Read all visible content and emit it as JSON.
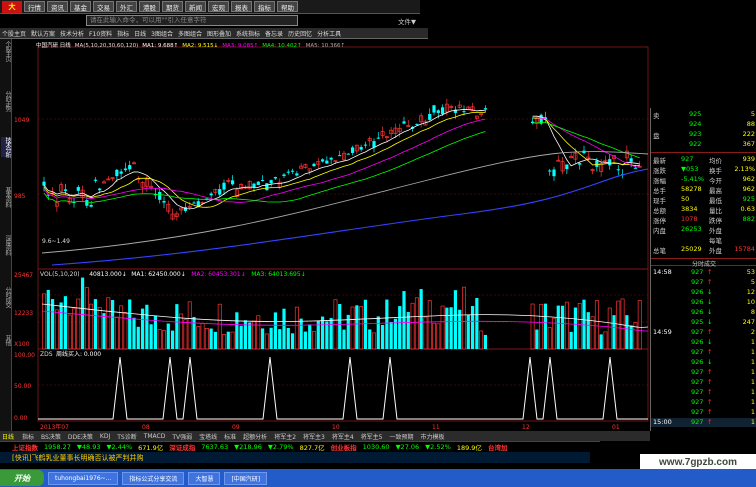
{
  "menu": {
    "items": [
      "行情",
      "资讯",
      "基金",
      "交易",
      "外汇",
      "港股",
      "期货",
      "新闻",
      "宏观",
      "报表",
      "指标",
      "帮助"
    ],
    "search_placeholder": "请在此输入命令，可以用\"\"引入任意字符",
    "right_label": "文件▼"
  },
  "toolbar": [
    "个股主页",
    "默认方案",
    "技术分析",
    "F10资料",
    "指标",
    "日线",
    "3图组合",
    "多图组合",
    "图形叠加",
    "系统指标",
    "备忘录",
    "历史回忆",
    "分析工具"
  ],
  "left_tabs": [
    "个股主页",
    "分时走势",
    "技术分析",
    "基本资料",
    "深度资料",
    "分时成交",
    "其他"
  ],
  "main": {
    "ma_line": [
      {
        "text": "中国汽研 日线",
        "color": "#ffffff"
      },
      {
        "text": "MA(5,10,20,30,60,120)",
        "color": "#dddddd"
      },
      {
        "text": "MA1: 9.688↑",
        "color": "#ffffff"
      },
      {
        "text": "MA2: 9.515↓",
        "color": "#ffff00"
      },
      {
        "text": "MA3: 9.085↑",
        "color": "#ff00ff"
      },
      {
        "text": "MA4: 10.402↑",
        "color": "#00ff00"
      },
      {
        "text": "MA5: 10.366↑",
        "color": "#aaaaaa"
      }
    ],
    "price_ticks": [
      "1049",
      "985"
    ],
    "low_label": "9.6~1.49",
    "vol_line": [
      {
        "text": "VOL(5,10,20)",
        "color": "#dddddd"
      },
      {
        "text": "40813.000↓",
        "color": "#ffffff"
      },
      {
        "text": "MA1: 62450.000↓",
        "color": "#ffffff"
      },
      {
        "text": "MA2: 60453.301↓",
        "color": "#ff00ff"
      },
      {
        "text": "MA3: 64013.695↓",
        "color": "#00ff00"
      }
    ],
    "vol_ticks": [
      "25467",
      "12233",
      "X100"
    ],
    "sig_line": [
      {
        "text": "ZDS",
        "color": "#dddddd"
      },
      {
        "text": "周线买入: 0.000",
        "color": "#ffffff"
      }
    ],
    "sig_ticks": [
      "100.00",
      "50.00",
      "0.00"
    ],
    "date_labels": [
      "2013年07",
      "08",
      "09",
      "10",
      "11",
      "12",
      "01"
    ],
    "period_tab": "日线"
  },
  "right_panel": {
    "quotes": [
      {
        "label": "卖",
        "price": "925",
        "vol": "5"
      },
      {
        "label": "",
        "price": "924",
        "vol": "88"
      },
      {
        "label": "盘",
        "price": "923",
        "vol": "222"
      },
      {
        "label": "",
        "price": "922",
        "vol": "367"
      }
    ],
    "stats": [
      {
        "k1": "最新",
        "v1": "927",
        "k2": "均价",
        "v2": "939",
        "c1": "#00ff00",
        "c2": "#ffff00"
      },
      {
        "k1": "涨跌",
        "v1": "▼053",
        "k2": "换手",
        "v2": "2.13%",
        "c1": "#00ff00",
        "c2": "#ffff00"
      },
      {
        "k1": "涨幅",
        "v1": "-5.41%",
        "k2": "今开",
        "v2": "962",
        "c1": "#00ff00",
        "c2": "#ffff00"
      },
      {
        "k1": "总手",
        "v1": "58278",
        "k2": "最高",
        "v2": "962",
        "c1": "#ffff00",
        "c2": "#ffff00"
      },
      {
        "k1": "现手",
        "v1": "50",
        "k2": "最低",
        "v2": "925",
        "c1": "#ffff00",
        "c2": "#00ff00"
      },
      {
        "k1": "总额",
        "v1": "3834",
        "k2": "量比",
        "v2": "0.63",
        "c1": "#ffff00",
        "c2": "#ffff00"
      },
      {
        "k1": "涨停",
        "v1": "1078",
        "k2": "跌停",
        "v2": "882",
        "c1": "#ff3333",
        "c2": "#00ff00"
      },
      {
        "k1": "内盘",
        "v1": "26253",
        "k2": "外盘",
        "v2": "",
        "c1": "#00ff00",
        "c2": "#ff3333"
      },
      {
        "k1": "",
        "v1": "",
        "k2": "每笔",
        "v2": "",
        "c1": "#ffff00",
        "c2": "#ffff00"
      },
      {
        "k1": "总笔",
        "v1": "25029",
        "k2": "外盘",
        "v2": "15784",
        "c1": "#ffff00",
        "c2": "#ff3333"
      }
    ],
    "ticks_title": "分时成交",
    "ticks": [
      {
        "t": "14:58",
        "p": "927",
        "a": "↑",
        "v": "53"
      },
      {
        "t": "",
        "p": "927",
        "a": "↑",
        "v": "5"
      },
      {
        "t": "",
        "p": "926",
        "a": "↓",
        "v": "12"
      },
      {
        "t": "",
        "p": "926",
        "a": "↓",
        "v": "10"
      },
      {
        "t": "",
        "p": "926",
        "a": "↓",
        "v": "8"
      },
      {
        "t": "",
        "p": "925",
        "a": "↓",
        "v": "247"
      },
      {
        "t": "14:59",
        "p": "927",
        "a": "↑",
        "v": "2"
      },
      {
        "t": "",
        "p": "926",
        "a": "↓",
        "v": "1"
      },
      {
        "t": "",
        "p": "927",
        "a": "↑",
        "v": "1"
      },
      {
        "t": "",
        "p": "926",
        "a": "↓",
        "v": "1"
      },
      {
        "t": "",
        "p": "927",
        "a": "↑",
        "v": "1"
      },
      {
        "t": "",
        "p": "927",
        "a": "↑",
        "v": "1"
      },
      {
        "t": "",
        "p": "927",
        "a": "↑",
        "v": "1"
      },
      {
        "t": "",
        "p": "927",
        "a": "↑",
        "v": "1"
      },
      {
        "t": "",
        "p": "927",
        "a": "↑",
        "v": "1"
      },
      {
        "t": "15:00",
        "p": "927",
        "a": "↑",
        "v": "1"
      }
    ]
  },
  "bottom_tabs": [
    "指标",
    "BS决策",
    "DDE决策",
    "KDJ",
    "TS诊断",
    "TMACD",
    "TV强弱",
    "宝塔线",
    "标准",
    "超额分析",
    "将军主2",
    "将军主3",
    "将军主4",
    "将军主5",
    "一致预期",
    "市力模板"
  ],
  "ticker": [
    {
      "text": "上证指数",
      "color": "#ff3333"
    },
    {
      "text": "1958.27",
      "color": "#00ff00"
    },
    {
      "text": "▼48.93",
      "color": "#00ff00"
    },
    {
      "text": "▼2.44%",
      "color": "#00ff00"
    },
    {
      "text": "671.9亿",
      "color": "#ffff00"
    },
    {
      "text": "深证成指",
      "color": "#ff3333"
    },
    {
      "text": "7637.63",
      "color": "#00ff00"
    },
    {
      "text": "▼218.96",
      "color": "#00ff00"
    },
    {
      "text": "▼2.79%",
      "color": "#00ff00"
    },
    {
      "text": "827.7亿",
      "color": "#ffff00"
    },
    {
      "text": "创业板指",
      "color": "#ff3333"
    },
    {
      "text": "1030.60",
      "color": "#00ff00"
    },
    {
      "text": "▼27.06",
      "color": "#00ff00"
    },
    {
      "text": "▼2.52%",
      "color": "#00ff00"
    },
    {
      "text": "189.9亿",
      "color": "#ffff00"
    },
    {
      "text": "台湾加",
      "color": "#ff3333"
    }
  ],
  "news": "[快讯]飞鹤乳业董事长明确否认被严判并购",
  "watermark": "www.7gpzb.com",
  "taskbar": {
    "start": "开始",
    "tasks": [
      "tuhongbai1976~...",
      "指标公式分享交流",
      "大智慧",
      "[中国汽研]"
    ]
  },
  "colors": {
    "up": "#ff3333",
    "down": "#00ffff",
    "ma1": "#ffffff",
    "ma2": "#ffff00",
    "ma3": "#ff00ff",
    "ma4": "#00ff00",
    "ma5": "#aaaaaa",
    "ma6": "#3344ff"
  }
}
